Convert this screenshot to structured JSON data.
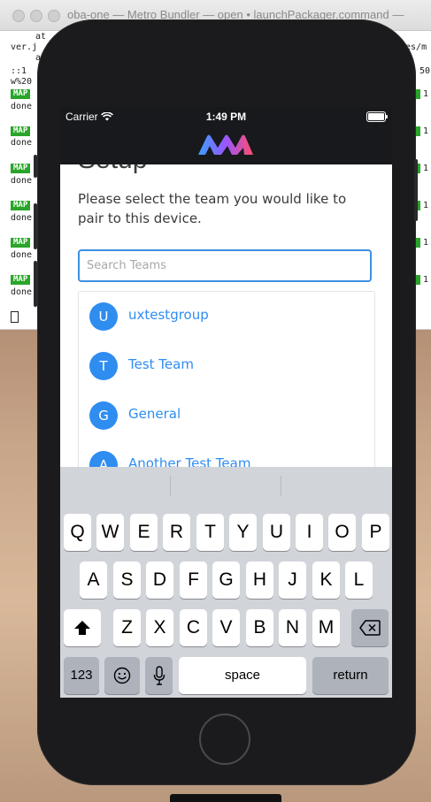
{
  "terminal": {
    "title": "oba-one — Metro Bundler — open • launchPackager.command —",
    "lines_left": [
      "at",
      "ver.j",
      "a",
      "::1",
      "w%20"
    ],
    "lines_right": [
      "les/m",
      "50"
    ],
    "map_badge": "MAP",
    "done_label": "done",
    "right_counts": [
      "1",
      "1",
      "1",
      "1",
      "1",
      "1"
    ]
  },
  "status_bar": {
    "carrier": "Carrier",
    "time": "1:49 PM"
  },
  "setup": {
    "title": "Setup",
    "instructions": "Please select the team you would like to pair to this device.",
    "search_placeholder": "Search Teams",
    "teams": [
      {
        "initial": "U",
        "name": "uxtestgroup"
      },
      {
        "initial": "T",
        "name": "Test Team"
      },
      {
        "initial": "G",
        "name": "General"
      },
      {
        "initial": "A",
        "name": "Another Test Team"
      }
    ]
  },
  "keyboard": {
    "row1": [
      "Q",
      "W",
      "E",
      "R",
      "T",
      "Y",
      "U",
      "I",
      "O",
      "P"
    ],
    "row2": [
      "A",
      "S",
      "D",
      "F",
      "G",
      "H",
      "J",
      "K",
      "L"
    ],
    "row3": [
      "Z",
      "X",
      "C",
      "V",
      "B",
      "N",
      "M"
    ],
    "numbers_key": "123",
    "space_key": "space",
    "return_key": "return"
  },
  "colors": {
    "accent": "#2f8df0",
    "statusbar": "#17191c",
    "keyboard_bg": "#d1d4d9"
  },
  "icons": [
    "wifi-icon",
    "battery-icon",
    "emoji-icon",
    "microphone-icon",
    "shift-icon",
    "backspace-icon",
    "app-logo"
  ]
}
